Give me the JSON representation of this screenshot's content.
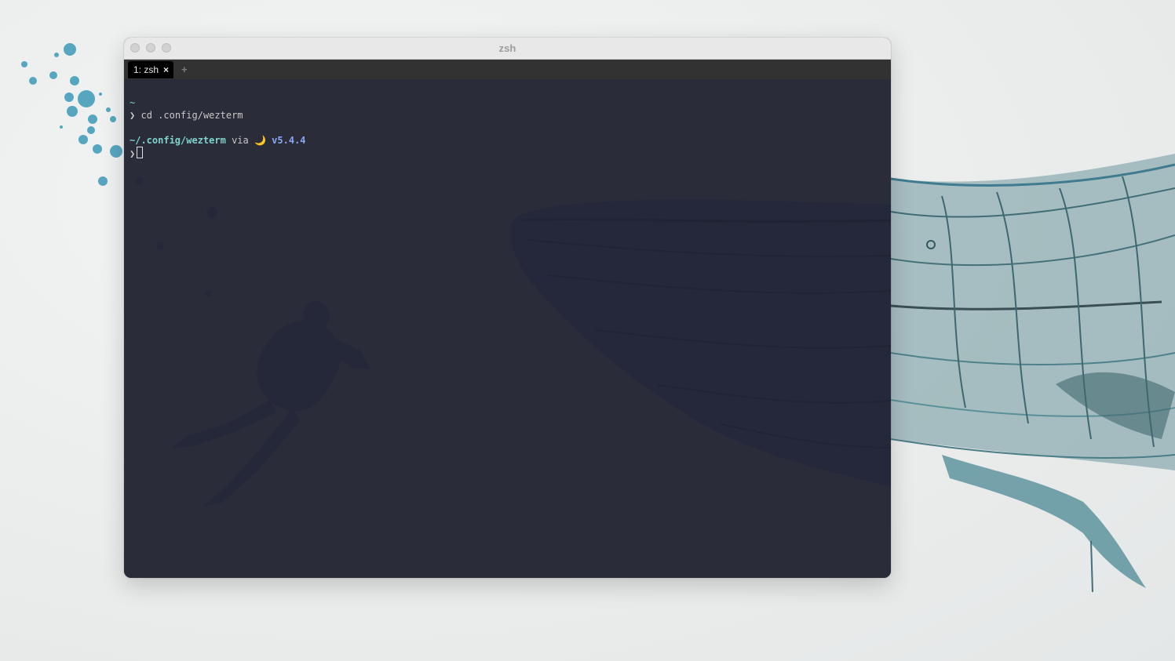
{
  "window": {
    "title": "zsh"
  },
  "tabs": [
    {
      "label": "1: zsh",
      "close_icon": "×",
      "active": true
    }
  ],
  "new_tab_icon": "+",
  "terminal": {
    "lines": [
      {
        "prompt_path": "~"
      },
      {
        "prompt_symbol": "❯",
        "command": "cd .config/wezterm"
      },
      {
        "blank": ""
      },
      {
        "prompt_path": "~/.config/wezterm",
        "via": "via",
        "moon_icon": "🌙",
        "version": "v5.4.4"
      },
      {
        "prompt_symbol": "❯",
        "cursor": ""
      }
    ]
  },
  "colors": {
    "terminal_bg": "#2b2c3a",
    "prompt_cyan": "#7ed3cb",
    "version_blue": "#8aa8f0",
    "tab_bar": "#323232",
    "active_tab": "#000000",
    "titlebar": "#e8e8e8"
  }
}
